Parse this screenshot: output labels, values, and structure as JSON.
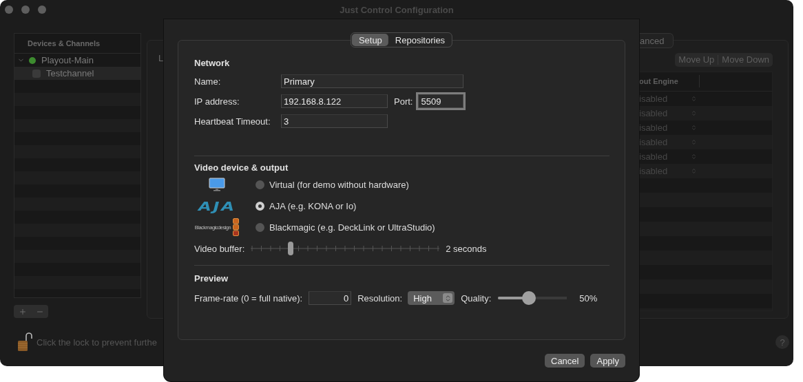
{
  "window": {
    "title": "Just Control Configuration"
  },
  "sidebar": {
    "header": "Devices & Channels",
    "items": [
      {
        "label": "Playout-Main",
        "expanded": true,
        "color": "#3d8b2f",
        "children": [
          {
            "label": "Testchannel",
            "selected": true,
            "checked": false
          }
        ]
      }
    ]
  },
  "main_panel": {
    "label": "L",
    "tab": "anced",
    "buttons": [
      "Move Up",
      "Move Down"
    ],
    "table": {
      "columns": [
        "out Engine"
      ],
      "rows": [
        "isabled",
        "isabled",
        "isabled",
        "isabled",
        "isabled",
        "isabled"
      ]
    }
  },
  "lock_hint": "Click the lock to prevent furthe",
  "help": "?",
  "sheet": {
    "tabs": [
      {
        "label": "Setup",
        "selected": true
      },
      {
        "label": "Repositories",
        "selected": false
      }
    ],
    "network": {
      "title": "Network",
      "name": {
        "label": "Name:",
        "value": "Primary"
      },
      "ip": {
        "label": "IP address:",
        "value": "192.168.8.122"
      },
      "port": {
        "label": "Port:",
        "value": "5509",
        "focused": true
      },
      "heartbeat": {
        "label": "Heartbeat Timeout:",
        "value": "3"
      }
    },
    "video": {
      "title": "Video device & output",
      "devices": [
        {
          "kind": "monitor",
          "label": "Virtual (for demo without hardware)",
          "selected": false
        },
        {
          "kind": "aja",
          "logo_text": "AJA",
          "label": "AJA (e.g. KONA or Io)",
          "selected": true
        },
        {
          "kind": "blackmagic",
          "logo_text": "Blackmagicdesign",
          "label": "Blackmagic (e.g. DeckLink or UltraStudio)",
          "selected": false
        }
      ],
      "buffer": {
        "label": "Video buffer:",
        "level": 0.21,
        "reading": "2 seconds"
      }
    },
    "preview": {
      "title": "Preview",
      "framerate": {
        "label": "Frame-rate (0 = full native):",
        "value": "0"
      },
      "resolution": {
        "label": "Resolution:",
        "value": "High"
      },
      "quality": {
        "label": "Quality:",
        "level": 0.45,
        "reading": "50%"
      }
    },
    "buttons": [
      "Cancel",
      "Apply"
    ]
  }
}
